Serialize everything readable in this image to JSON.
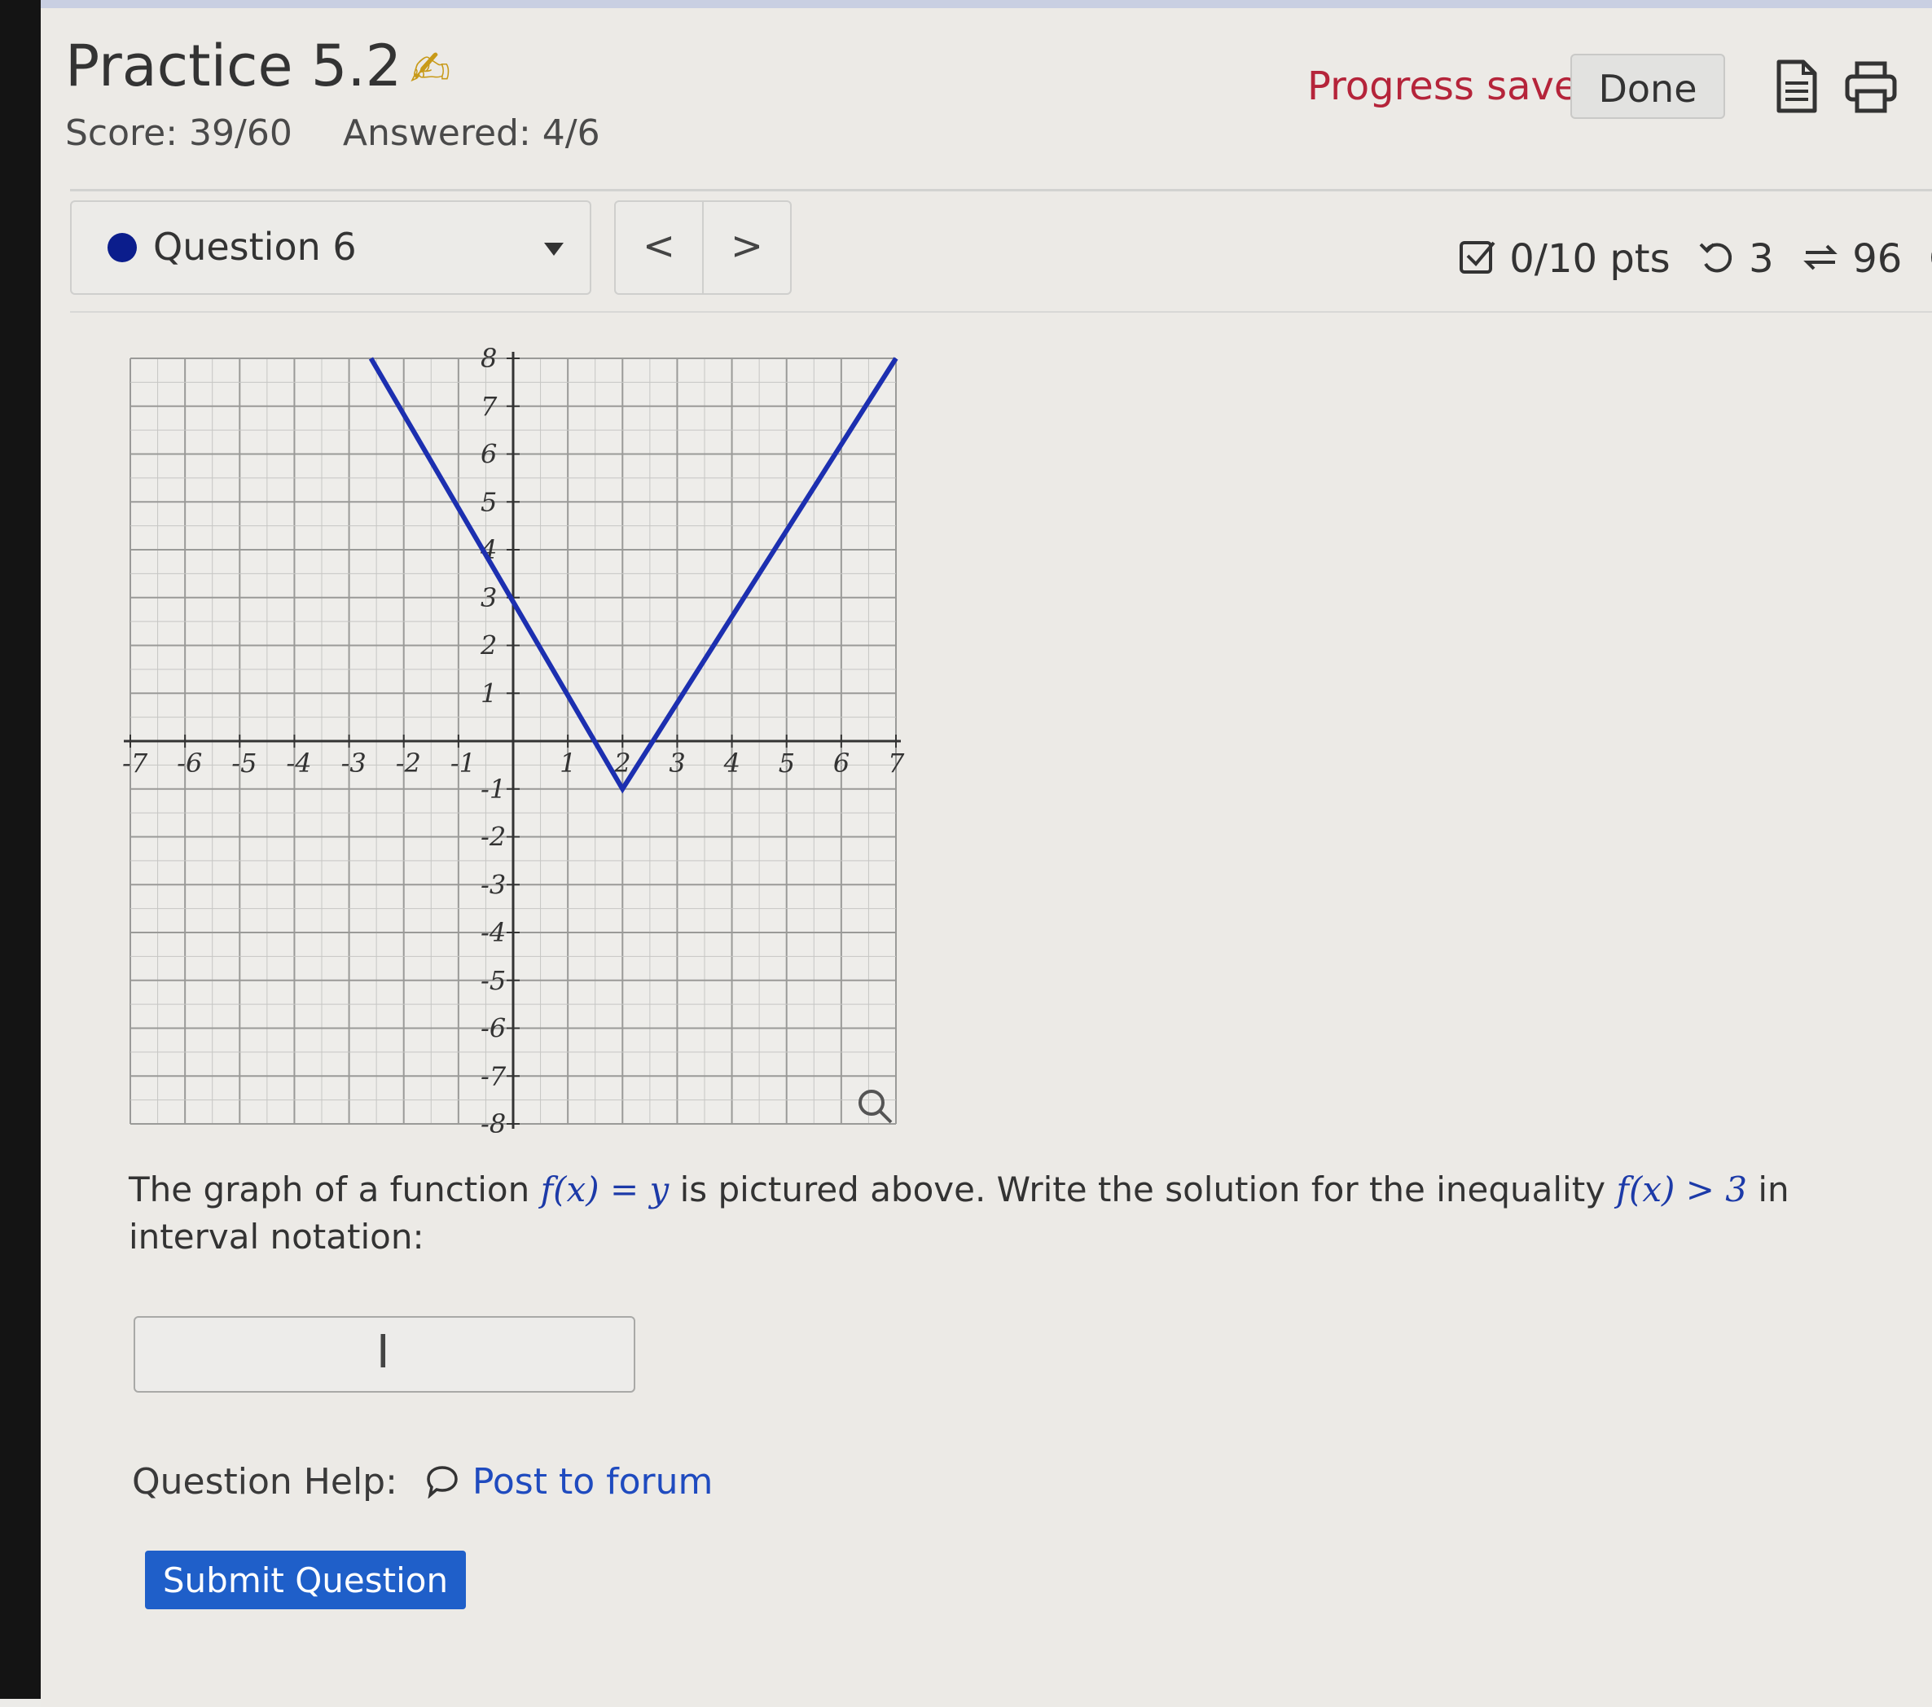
{
  "header": {
    "title": "Practice 5.2",
    "pen_icon": "✍",
    "score": "Score: 39/60",
    "answered": "Answered: 4/6",
    "progress_text": "Progress saved",
    "done_label": "Done"
  },
  "icons": {
    "notes": "notes-icon",
    "print": "print-icon",
    "prev": "chevron-left-icon",
    "next": "chevron-right-icon",
    "points": "checkbox-icon",
    "retry": "retry-icon",
    "attempts": "repeat-icon",
    "info": "info-icon",
    "forum": "speech-bubble-icon"
  },
  "question_nav": {
    "current": "Question 6",
    "prev_label": "<",
    "next_label": ">"
  },
  "stats": {
    "points": "0/10 pts",
    "retries": "3",
    "attempts": "96"
  },
  "colors": {
    "accent_blue": "#1f5fc9",
    "graph_line": "#1c2fb0",
    "progress_red": "#b5243a",
    "question_dot": "#0b1d8c"
  },
  "chart_data": {
    "type": "line",
    "xlim": [
      -7,
      7
    ],
    "ylim": [
      -8,
      8
    ],
    "grid": true,
    "x_ticks": [
      "-7",
      "-6",
      "-5",
      "-4",
      "-3",
      "-2",
      "-1",
      "1",
      "2",
      "3",
      "4",
      "5",
      "6",
      "7"
    ],
    "y_ticks": [
      "8",
      "7",
      "6",
      "5",
      "4",
      "3",
      "2",
      "1",
      "-1",
      "-2",
      "-3",
      "-4",
      "-5",
      "-6",
      "-7",
      "-8"
    ],
    "series": [
      {
        "x": [
          -2.6,
          2,
          7
        ],
        "y": [
          8,
          -1,
          8
        ]
      }
    ]
  },
  "question": {
    "text_a": "The graph of a function ",
    "math_a": "f(x) = y",
    "text_b": " is pictured above. Write the solution for the inequality ",
    "math_b": "f(x) > 3",
    "text_c": " in interval notation:"
  },
  "answer": {
    "value": "",
    "placeholder": ""
  },
  "help": {
    "label": "Question Help:",
    "forum_link": "Post to forum"
  },
  "submit_label": "Submit Question"
}
